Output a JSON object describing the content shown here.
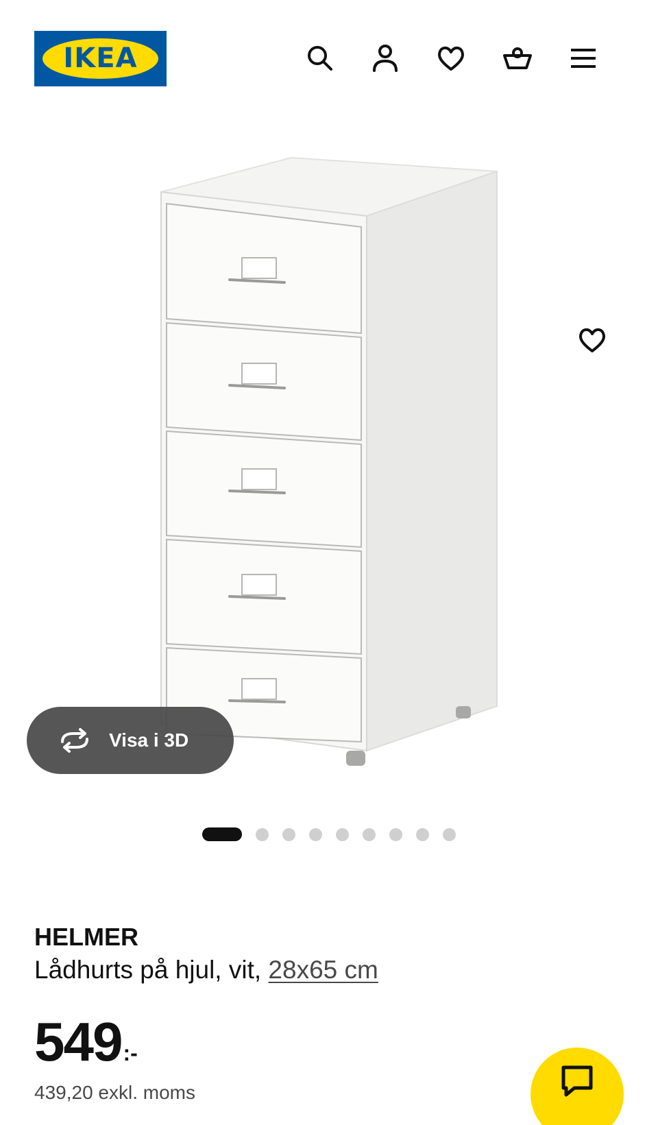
{
  "header": {
    "logo_text": "IKEA",
    "logo_reg": "®",
    "icons": [
      "search-icon",
      "account-icon",
      "heart-icon",
      "basket-icon",
      "menu-icon"
    ]
  },
  "gallery": {
    "view_3d_label": "Visa i 3D",
    "image_count": 9,
    "active_image": 1
  },
  "product": {
    "name": "HELMER",
    "description": "Lådhurts på hjul, vit, ",
    "dimensions": "28x65 cm",
    "price": "549",
    "price_suffix": ":-",
    "price_ex_vat": "439,20 exkl. moms"
  },
  "colors": {
    "ikea_blue": "#0058a3",
    "ikea_yellow": "#ffdb00",
    "text": "#111111",
    "muted": "#484848"
  }
}
